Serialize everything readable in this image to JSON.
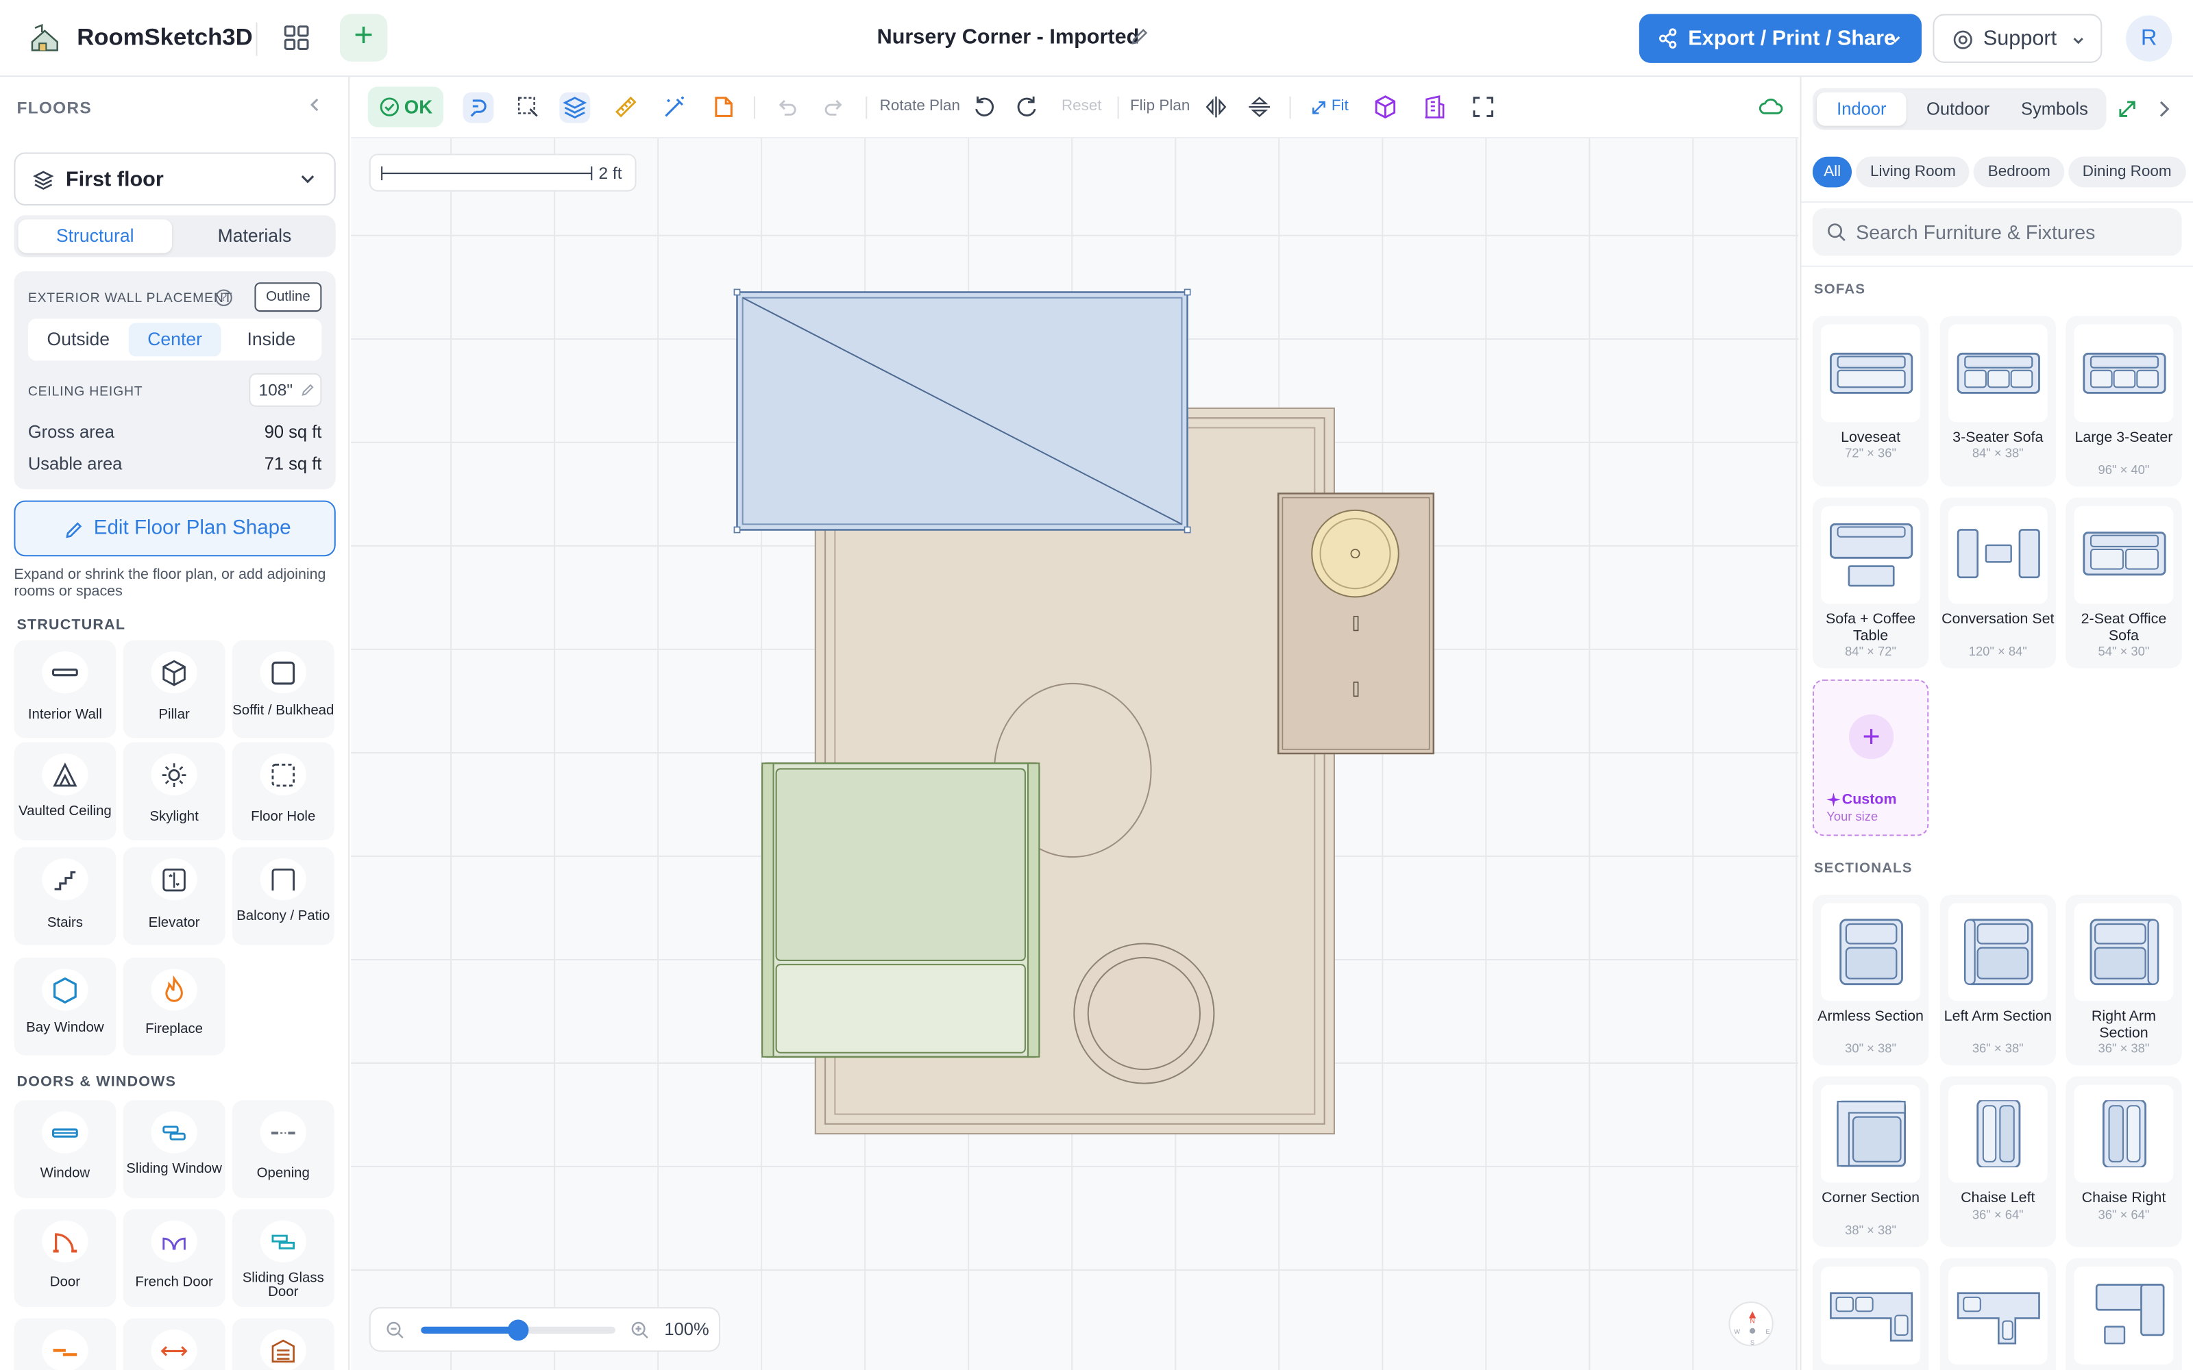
{
  "header": {
    "app_name": "RoomSketch3D",
    "document_title": "Nursery Corner - Imported",
    "export_label": "Export / Print / Share",
    "support_label": "Support",
    "avatar_initial": "R"
  },
  "left_panel": {
    "header": "FLOORS",
    "floor_selected": "First floor",
    "tabs": [
      "Structural",
      "Materials"
    ],
    "active_tab": "Structural",
    "wall_placement_label": "EXTERIOR WALL PLACEMENT",
    "outline_label": "Outline",
    "placement_options": [
      "Outside",
      "Center",
      "Inside"
    ],
    "placement_selected": "Center",
    "ceiling_label": "CEILING HEIGHT",
    "ceiling_value": "108\"",
    "gross_area_label": "Gross area",
    "gross_area_value": "90 sq ft",
    "usable_area_label": "Usable area",
    "usable_area_value": "71 sq ft",
    "edit_shape_label": "Edit Floor Plan Shape",
    "edit_shape_hint": "Expand or shrink the floor plan, or add adjoining rooms or spaces",
    "structural_header": "STRUCTURAL",
    "structural_items": [
      {
        "label": "Interior Wall",
        "icon": "interior-wall-icon"
      },
      {
        "label": "Pillar",
        "icon": "pillar-icon"
      },
      {
        "label": "Soffit / Bulkhead",
        "icon": "soffit-icon"
      },
      {
        "label": "Vaulted Ceiling",
        "icon": "vaulted-ceiling-icon"
      },
      {
        "label": "Skylight",
        "icon": "skylight-icon"
      },
      {
        "label": "Floor Hole",
        "icon": "floor-hole-icon"
      },
      {
        "label": "Stairs",
        "icon": "stairs-icon"
      },
      {
        "label": "Elevator",
        "icon": "elevator-icon"
      },
      {
        "label": "Balcony / Patio",
        "icon": "balcony-icon"
      },
      {
        "label": "Bay Window",
        "icon": "bay-window-icon"
      },
      {
        "label": "Fireplace",
        "icon": "fireplace-icon"
      }
    ],
    "doors_header": "DOORS & WINDOWS",
    "door_items": [
      {
        "label": "Window",
        "icon": "window-icon"
      },
      {
        "label": "Sliding Window",
        "icon": "sliding-window-icon"
      },
      {
        "label": "Opening",
        "icon": "opening-icon"
      },
      {
        "label": "Door",
        "icon": "door-icon"
      },
      {
        "label": "French Door",
        "icon": "french-door-icon"
      },
      {
        "label": "Sliding Glass Door",
        "icon": "sliding-glass-door-icon"
      }
    ]
  },
  "toolbar": {
    "status": "OK",
    "rotate_label": "Rotate Plan",
    "reset_label": "Reset",
    "flip_label": "Flip Plan",
    "fit_label": "Fit"
  },
  "canvas": {
    "scale_label": "2 ft",
    "zoom_value": "100%",
    "zoom_fraction": 0.5,
    "compass_labels": {
      "n": "N",
      "w": "W",
      "e": "E",
      "s": "S"
    }
  },
  "right_panel": {
    "tabs": [
      "Indoor",
      "Outdoor",
      "Symbols"
    ],
    "active_tab": "Indoor",
    "categories": [
      "All",
      "Living Room",
      "Bedroom",
      "Dining Room"
    ],
    "active_category": "All",
    "search_placeholder": "Search Furniture & Fixtures",
    "sofas_header": "SOFAS",
    "sofas": [
      {
        "name": "Loveseat",
        "dims": "72\" × 36\""
      },
      {
        "name": "3-Seater Sofa",
        "dims": "84\" × 38\""
      },
      {
        "name": "Large 3-Seater",
        "dims": "96\" × 40\""
      },
      {
        "name": "Sofa + Coffee Table",
        "dims": "84\" × 72\""
      },
      {
        "name": "Conversation Set",
        "dims": "120\" × 84\""
      },
      {
        "name": "2-Seat Office Sofa",
        "dims": "54\" × 30\""
      }
    ],
    "custom": {
      "name": "Custom",
      "sub": "Your size"
    },
    "sectionals_header": "SECTIONALS",
    "sectionals": [
      {
        "name": "Armless Section",
        "dims": "30\" × 38\""
      },
      {
        "name": "Left Arm Section",
        "dims": "36\" × 38\""
      },
      {
        "name": "Right Arm Section",
        "dims": "36\" × 38\""
      },
      {
        "name": "Corner Section",
        "dims": "38\" × 38\""
      },
      {
        "name": "Chaise Left",
        "dims": "36\" × 64\""
      },
      {
        "name": "Chaise Right",
        "dims": "36\" × 64\""
      }
    ]
  },
  "colors": {
    "accent": "#2f7de1",
    "ok_green": "#1f9d55",
    "custom_purple": "#9333ea",
    "rug": "#e6dccd",
    "sofa_green": "#d4dfc7",
    "blue_piece": "#cfdcee",
    "side_cabinet": "#d8c9b8"
  }
}
